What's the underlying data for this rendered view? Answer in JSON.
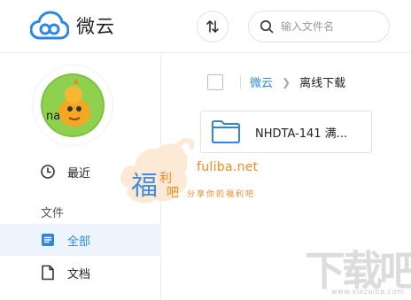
{
  "header": {
    "app_name": "微云",
    "search": {
      "placeholder": "输入文件名",
      "value": ""
    },
    "sort_icon": "sort-arrows-icon",
    "accent_color": "#2e86de"
  },
  "sidebar": {
    "avatar_icon": "user-avatar",
    "items": [
      {
        "label": "最近",
        "icon": "clock-icon"
      },
      {
        "label": "全部",
        "icon": "list-icon",
        "active": true
      },
      {
        "label": "文档",
        "icon": "document-icon"
      }
    ],
    "section_label": "文件"
  },
  "main": {
    "breadcrumb": {
      "root": "微云",
      "current": "离线下载"
    },
    "files": [
      {
        "name": "NHDTA-141 满...",
        "icon": "folder-icon"
      }
    ]
  },
  "watermark": {
    "logo_text": "福利吧",
    "site": "fuliba.net",
    "tagline": "分享你的福利吧",
    "corner_logo": "下载吧",
    "corner_url": "www.xiazaiba.com",
    "color": "#f08a24"
  }
}
